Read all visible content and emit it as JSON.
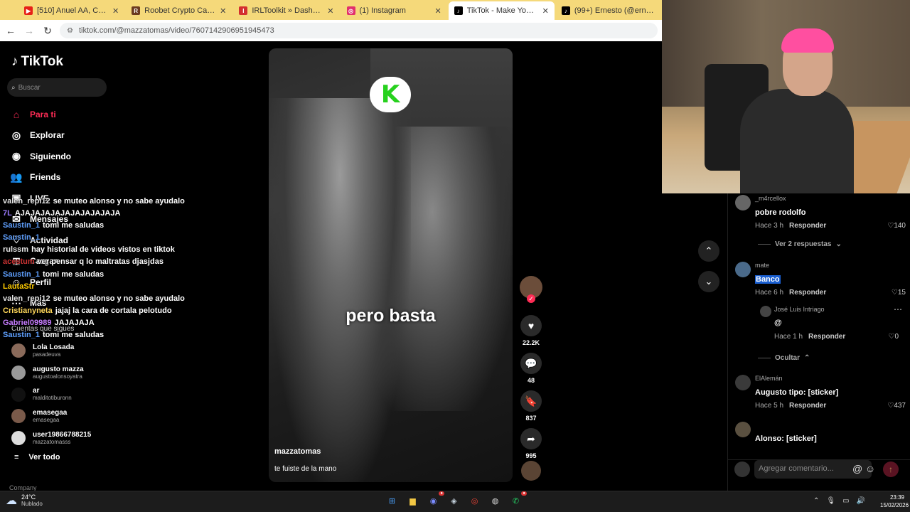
{
  "browser": {
    "tabs": [
      {
        "title": "[510] Anuel AA, Chris Jedi, RO",
        "favicon_color": "#e62117",
        "active": false
      },
      {
        "title": "Roobet Crypto Casino | Best Bi",
        "favicon_color": "#6b3a1f",
        "active": false
      },
      {
        "title": "IRLToolkit » Dashboard",
        "favicon_color": "#d32f2f",
        "active": false
      },
      {
        "title": "(1) Instagram",
        "favicon_color": "#e1306c",
        "active": false
      },
      {
        "title": "TikTok - Make Your Day",
        "favicon_color": "#000000",
        "active": true
      },
      {
        "title": "(99+) Ernesto (@ernestoca",
        "favicon_color": "#000000",
        "active": false
      }
    ],
    "url": "tiktok.com/@mazzatomas/video/7607142906951945473"
  },
  "tiktok": {
    "logo": "TikTok",
    "search_placeholder": "Buscar",
    "nav": [
      {
        "label": "Para ti",
        "icon": "home-icon"
      },
      {
        "label": "Explorar",
        "icon": "compass-icon"
      },
      {
        "label": "Siguiendo",
        "icon": "following-icon"
      },
      {
        "label": "Friends",
        "icon": "friends-icon"
      },
      {
        "label": "LIVE",
        "icon": "live-icon"
      },
      {
        "label": "Mensajes",
        "icon": "message-icon"
      },
      {
        "label": "Actividad",
        "icon": "activity-icon"
      },
      {
        "label": "Cargar",
        "icon": "upload-icon"
      },
      {
        "label": "Perfil",
        "icon": "profile-icon"
      },
      {
        "label": "Más",
        "icon": "more-icon"
      }
    ],
    "following_label": "Cuentas que sigues",
    "accounts": [
      {
        "name": "Lola Losada",
        "handle": "pasadeuva"
      },
      {
        "name": "augusto mazza",
        "handle": "augustoalonsoyatra"
      },
      {
        "name": "ar",
        "handle": "malditotiburonn"
      },
      {
        "name": "emasegaa",
        "handle": "emasegaa"
      },
      {
        "name": "user19866788215",
        "handle": "mazzatomasss"
      }
    ],
    "see_all": "Ver todo",
    "company": "Company"
  },
  "chat": [
    {
      "user": "valen_repi12",
      "color": "#e6e6e6",
      "msg": "se muteo alonso y no sabe ayudalo"
    },
    {
      "user": "7L",
      "color": "#9b7bff",
      "msg": "AJAJAJAJAJAJAJAJAJAJA"
    },
    {
      "user": "Saustin_1",
      "color": "#5fa0ff",
      "msg": "tomi me saludas"
    },
    {
      "user": "Saustin_1",
      "color": "#5fa0ff",
      "msg": ""
    },
    {
      "user": "rulssm",
      "color": "#e6e6e6",
      "msg": "hay historial de videos vistos en tiktok"
    },
    {
      "user": "acestum",
      "color": "#c33",
      "msg": "ver pensar q lo maltratas djasjdas"
    },
    {
      "user": "Saustin_1",
      "color": "#5fa0ff",
      "msg": "tomi me saludas"
    },
    {
      "user": "LautaStr",
      "color": "#ffcc00",
      "msg": ""
    },
    {
      "user": "valen_repi12",
      "color": "#e6e6e6",
      "msg": "se muteo alonso y no sabe ayudalo"
    },
    {
      "user": "Cristianyneta",
      "color": "#ffd75a",
      "msg": "jajaj la cara de cortala pelotudo"
    },
    {
      "user": "Gabriel09989",
      "color": "#c77dff",
      "msg": "JAJAJAJA"
    },
    {
      "user": "Saustin_1",
      "color": "#5fa0ff",
      "msg": "tomi me saludas"
    }
  ],
  "video": {
    "caption": "pero basta",
    "badge_letter": "K",
    "author": "mazzatomas",
    "description": "te fuiste de la mano",
    "likes": "22.2K",
    "comments": "48",
    "saves": "837",
    "shares": "995"
  },
  "comments": [
    {
      "user": "_m4rcellox",
      "text": "pobre rodolfo",
      "time": "Hace 3 h",
      "reply": "Responder",
      "likes": "140"
    },
    {
      "replies_label": "Ver 2 respuestas"
    },
    {
      "user": "mate",
      "text": "Banco",
      "time": "Hace 6 h",
      "reply": "Responder",
      "likes": "15"
    },
    {
      "user": "José Luis Intriago",
      "text": "@",
      "time": "Hace 1 h",
      "reply": "Responder",
      "likes": "0"
    },
    {
      "hide_label": "Ocultar"
    },
    {
      "user": "ElAlemán",
      "text": "Augusto tipo: [sticker]",
      "time": "Hace 5 h",
      "reply": "Responder",
      "likes": "437"
    },
    {
      "user": "",
      "text": "Alonso: [sticker]",
      "time": "",
      "reply": "",
      "likes": ""
    }
  ],
  "add_comment_placeholder": "Agregar comentario...",
  "taskbar": {
    "temp": "24°C",
    "condition": "Nublado",
    "time": "23:39",
    "date": "15/02/2026"
  }
}
